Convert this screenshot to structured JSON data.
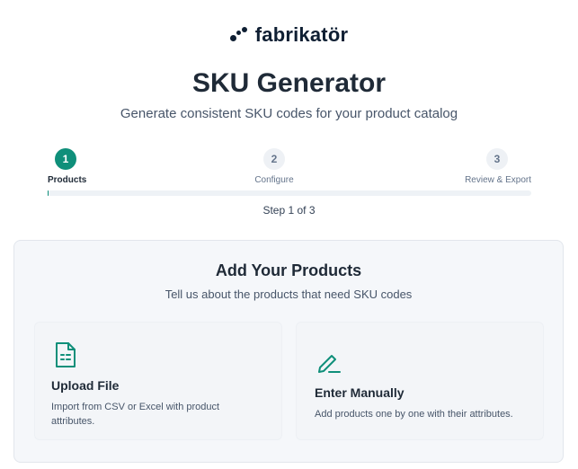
{
  "brand": {
    "name": "fabrikatör",
    "color": "#0f1f33"
  },
  "header": {
    "title": "SKU Generator",
    "subtitle": "Generate consistent SKU codes for your product catalog"
  },
  "stepper": {
    "steps": [
      {
        "number": "1",
        "label": "Products",
        "state": "active"
      },
      {
        "number": "2",
        "label": "Configure",
        "state": "upcoming"
      },
      {
        "number": "3",
        "label": "Review & Export",
        "state": "upcoming"
      }
    ],
    "progress_percent": 0,
    "status": "Step 1 of 3",
    "accent": "#0f8f7a"
  },
  "card": {
    "title": "Add Your Products",
    "subtitle": "Tell us about the products that need SKU codes",
    "options": [
      {
        "icon": "file-spreadsheet-icon",
        "title": "Upload File",
        "description": "Import from CSV or Excel with product attributes."
      },
      {
        "icon": "pencil-icon",
        "title": "Enter Manually",
        "description": "Add products one by one with their attributes."
      }
    ]
  }
}
